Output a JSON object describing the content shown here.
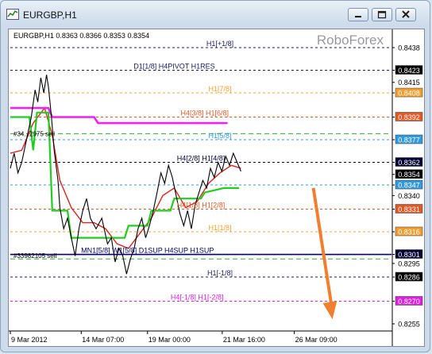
{
  "window": {
    "title": "EURGBP,H1",
    "controls": [
      "minimize",
      "restore",
      "close"
    ]
  },
  "chart": {
    "symbol_info": "EURGBP,H1  0.8363 0.8366 0.8353 0.8354",
    "watermark": "RoboForex",
    "price_labels": [
      {
        "text": "0.8438",
        "price": 0.8438,
        "bg": "#ffffff",
        "fg": "#000000"
      },
      {
        "text": "0.8423",
        "price": 0.8423,
        "bg": "#000000",
        "fg": "#ffffff"
      },
      {
        "text": "0.8415",
        "price": 0.8415,
        "bg": "#ffffff",
        "fg": "#000000"
      },
      {
        "text": "0.8408",
        "price": 0.8408,
        "bg": "#f0a030",
        "fg": "#ffffff"
      },
      {
        "text": "0.8392",
        "price": 0.8392,
        "bg": "#e05a28",
        "fg": "#ffffff"
      },
      {
        "text": "0.8377",
        "price": 0.8377,
        "bg": "#3399dd",
        "fg": "#ffffff"
      },
      {
        "text": "0.8362",
        "price": 0.8362,
        "bg": "#000033",
        "fg": "#ffffff"
      },
      {
        "text": "0.8354",
        "price": 0.8354,
        "bg": "#000000",
        "fg": "#ffffff"
      },
      {
        "text": "0.8347",
        "price": 0.8347,
        "bg": "#3399dd",
        "fg": "#ffffff"
      },
      {
        "text": "0.8340",
        "price": 0.834,
        "bg": "#ffffff",
        "fg": "#000000"
      },
      {
        "text": "0.8331",
        "price": 0.8331,
        "bg": "#e05a28",
        "fg": "#ffffff"
      },
      {
        "text": "0.8316",
        "price": 0.8316,
        "bg": "#f0a030",
        "fg": "#ffffff"
      },
      {
        "text": "0.8301",
        "price": 0.8301,
        "bg": "#000033",
        "fg": "#ffffff"
      },
      {
        "text": "0.8295",
        "price": 0.8295,
        "bg": "#ffffff",
        "fg": "#000000"
      },
      {
        "text": "0.8286",
        "price": 0.8286,
        "bg": "#000000",
        "fg": "#ffffff"
      },
      {
        "text": "0.8270",
        "price": 0.827,
        "bg": "#e020e0",
        "fg": "#ffffff"
      },
      {
        "text": "0.8255",
        "price": 0.8255,
        "bg": "#ffffff",
        "fg": "#000000"
      }
    ],
    "time_labels": [
      {
        "text": "9 Mar 2012",
        "t": 0
      },
      {
        "text": "14 Mar 07:00",
        "t": 0.186
      },
      {
        "text": "19 Mar 00:00",
        "t": 0.36
      },
      {
        "text": "21 Mar 16:00",
        "t": 0.556
      },
      {
        "text": "26 Mar 09:00",
        "t": 0.745
      }
    ],
    "levels": [
      {
        "label": "H1[+1/8]",
        "price": 0.8438,
        "color": "#1a1a60",
        "dash": "3,3",
        "label_t": 0.55
      },
      {
        "label": "D1[1/8] H4PIVOT H1RES",
        "price": 0.8423,
        "color": "#1a1a60",
        "dash": "3,3",
        "label_t": 0.43
      },
      {
        "label": "H1[7/8]",
        "price": 0.8408,
        "color": "#f0a030",
        "dash": "3,3",
        "label_t": 0.55
      },
      {
        "label": "H4[3/8] H1[6/8]",
        "price": 0.8392,
        "color": "#e05a28",
        "dash": "3,3",
        "label_t": 0.51
      },
      {
        "label": "H1[5/8]",
        "price": 0.8377,
        "color": "#3399dd",
        "dash": "3,3",
        "label_t": 0.55
      },
      {
        "label": "H4[2/8] H1[4/8]",
        "price": 0.8362,
        "color": "#000033",
        "dash": "3,3",
        "label_t": 0.5
      },
      {
        "label": "",
        "price": 0.8347,
        "color": "#3399dd",
        "dash": "3,3",
        "label_t": 0.55
      },
      {
        "label": "H4[1/8] H1[2/8]",
        "price": 0.8331,
        "color": "#e05a28",
        "dash": "3,3",
        "label_t": 0.5
      },
      {
        "label": "H1[1/8]",
        "price": 0.8316,
        "color": "#f0a030",
        "dash": "3,3",
        "label_t": 0.55
      },
      {
        "label": "MN1[5/8] W1[5/8] D1SUP H4SUP H1SUP",
        "price": 0.8301,
        "color": "#000066",
        "dash": "",
        "label_t": 0.36
      },
      {
        "label": "H1[-1/8]",
        "price": 0.8286,
        "color": "#1a1a60",
        "dash": "3,3",
        "label_t": 0.55
      },
      {
        "label": "H4[-1/8] H1[-2/8]",
        "price": 0.827,
        "color": "#e020e0",
        "dash": "3,3",
        "label_t": 0.49
      }
    ],
    "order_lines": [
      {
        "label": "#34...2975 sell",
        "price": 0.8381,
        "color": "#33aa33"
      },
      {
        "label": "#33982105 sell",
        "price": 0.8298,
        "color": "#33aa33"
      }
    ],
    "forecast_arrow": {
      "color": "#f08030",
      "from_t": 0.795,
      "from_price": 0.8345,
      "to_t": 0.845,
      "to_price": 0.8258
    }
  }
}
